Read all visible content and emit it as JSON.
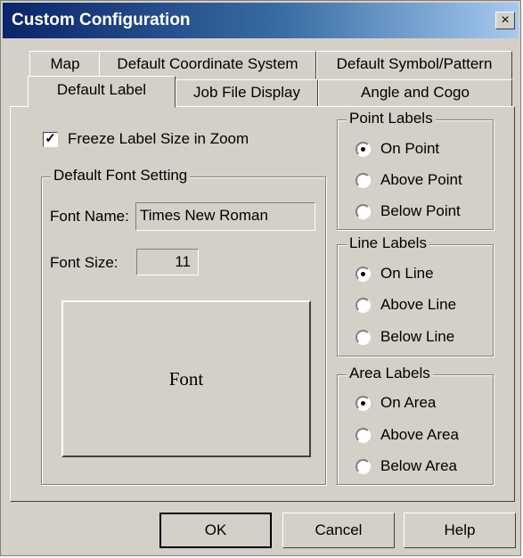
{
  "window": {
    "title": "Custom Configuration",
    "close_glyph": "×"
  },
  "tabs": {
    "row_back": [
      "Map",
      "Default Coordinate System",
      "Default Symbol/Pattern"
    ],
    "row_front": [
      "Default Label",
      "Job File Display",
      "Angle and Cogo"
    ],
    "active": "Default Label"
  },
  "general": {
    "freeze_label": "Freeze Label Size in Zoom",
    "freeze_checked": true,
    "check_glyph": "✓"
  },
  "font_setting": {
    "legend": "Default Font Setting",
    "font_name_label": "Font Name:",
    "font_name_value": "Times New Roman",
    "font_size_label": "Font Size:",
    "font_size_value": "11",
    "font_button": "Font"
  },
  "point_labels": {
    "legend": "Point Labels",
    "options": [
      "On Point",
      "Above Point",
      "Below Point"
    ],
    "selected": "On Point"
  },
  "line_labels": {
    "legend": "Line Labels",
    "options": [
      "On Line",
      "Above Line",
      "Below Line"
    ],
    "selected": "On Line"
  },
  "area_labels": {
    "legend": "Area Labels",
    "options": [
      "On Area",
      "Above Area",
      "Below Area"
    ],
    "selected": "On Area"
  },
  "buttons": {
    "ok": "OK",
    "cancel": "Cancel",
    "help": "Help"
  },
  "colors": {
    "face": "#d4d0c8",
    "title_start": "#0a246a",
    "title_end": "#a6caf0"
  }
}
